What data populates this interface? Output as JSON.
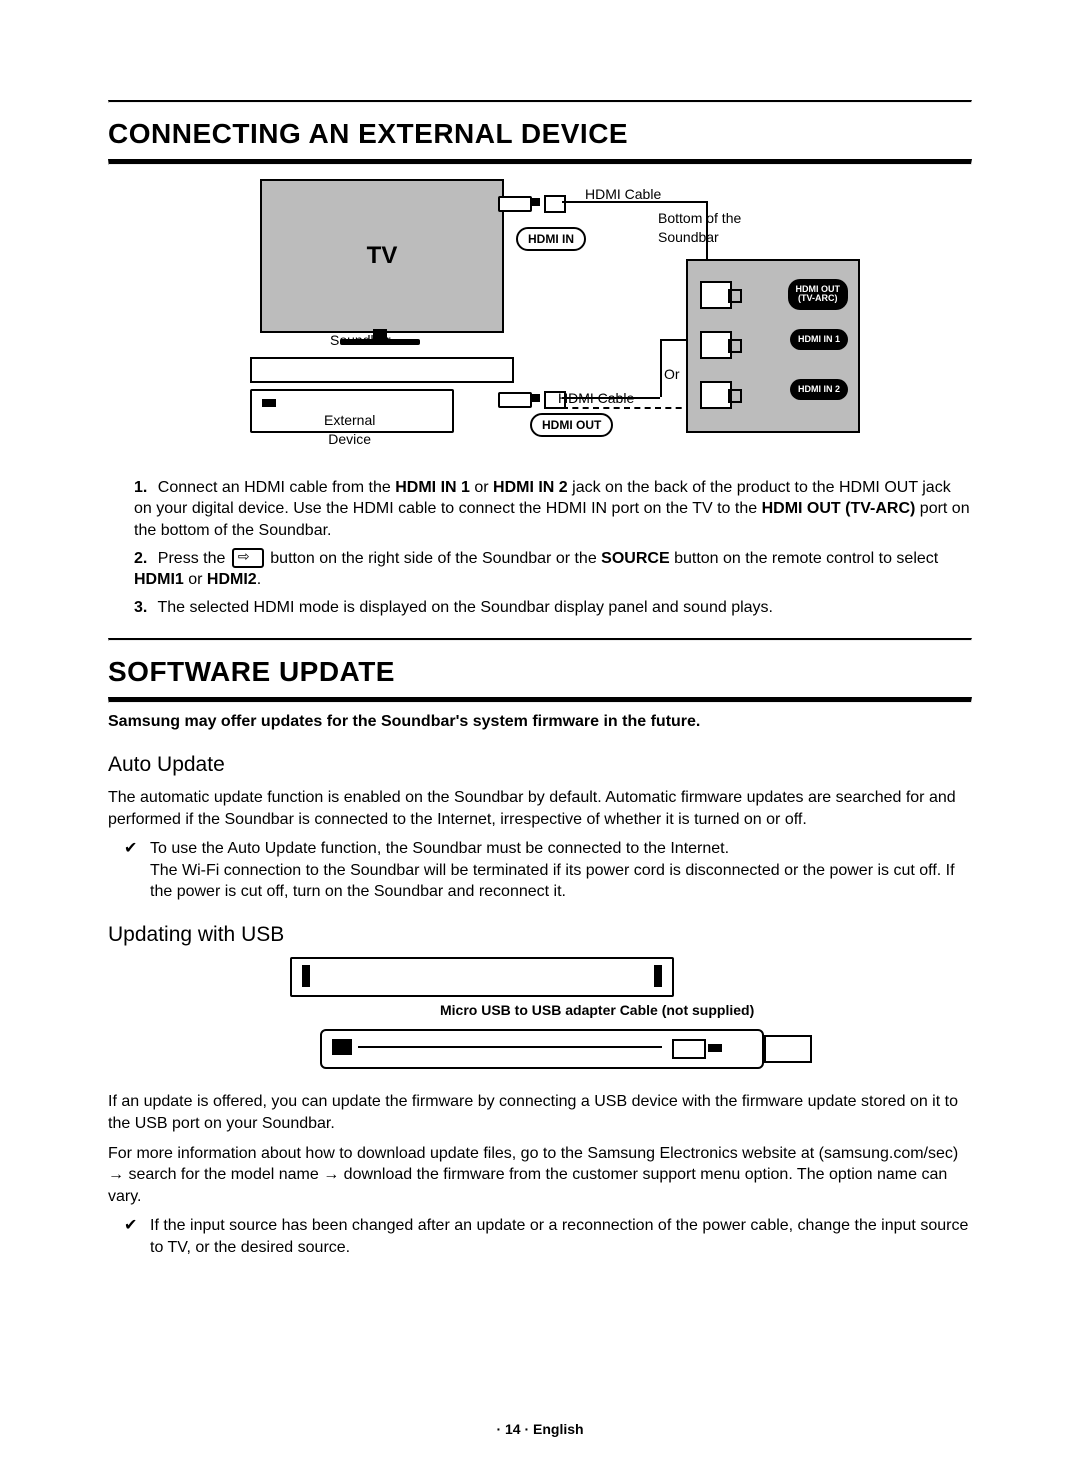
{
  "sections": {
    "connect": {
      "title": "CONNECTING AN EXTERNAL DEVICE",
      "diagram": {
        "tv_label": "TV",
        "hdmi_in_pill": "HDMI IN",
        "hdmi_out_pill": "HDMI OUT",
        "soundbar_label": "Soundbar",
        "external_device_label": "External\nDevice",
        "hdmi_cable_label_top": "HDMI Cable",
        "hdmi_cable_label_bottom": "HDMI Cable",
        "bottom_of_soundbar": "Bottom of the\nSoundbar",
        "or_label": "Or",
        "ports": {
          "out": "HDMI OUT\n(TV-ARC)",
          "in1": "HDMI IN 1",
          "in2": "HDMI IN 2"
        }
      },
      "steps": [
        {
          "n": "1.",
          "pre": "Connect an HDMI cable from the ",
          "b1": "HDMI IN 1",
          "mid1": " or ",
          "b2": "HDMI IN 2",
          "mid2": " jack on the back of the product to the HDMI OUT jack on your digital device. Use the HDMI cable to connect the HDMI IN port on the TV to the ",
          "b3": "HDMI OUT (TV-ARC)",
          "tail": " port on the bottom of the Soundbar."
        },
        {
          "n": "2.",
          "pre": "Press the ",
          "mid": " button on the right side of the Soundbar or the ",
          "b1": "SOURCE",
          "mid2": " button on the remote control to select ",
          "b2": "HDMI1",
          "or": " or ",
          "b3": "HDMI2",
          "tail": "."
        },
        {
          "n": "3.",
          "text": "The selected HDMI mode is displayed on the Soundbar display panel and sound plays."
        }
      ]
    },
    "software": {
      "title": "SOFTWARE UPDATE",
      "intro_bold": "Samsung may offer updates for the Soundbar's system firmware in the future.",
      "auto": {
        "heading": "Auto Update",
        "para": "The automatic update function is enabled on the Soundbar by default. Automatic firmware updates are searched for and performed if the Soundbar is connected to the Internet, irrespective of whether it is turned on or off.",
        "check": "To use the Auto Update function, the Soundbar must be connected to the Internet.\nThe Wi-Fi connection to the Soundbar will be terminated if its power cord is disconnected or the power is cut off. If the power is cut off, turn on the Soundbar and reconnect it."
      },
      "usb": {
        "heading": "Updating with USB",
        "caption": "Micro USB to USB adapter Cable (not supplied)",
        "para1": "If an update is offered, you can update the firmware by connecting a USB device with the firmware update stored on it to the USB port on your Soundbar.",
        "para2_pre": "For more information about how to download update files, go to the Samsung Electronics website at (samsung.com/sec) ",
        "arrow1": "→",
        "para2_mid1": " search for the model name ",
        "arrow2": "→",
        "para2_tail": " download the firmware from the customer support menu option. The option name can vary.",
        "check": "If the input source has been changed after an update or a reconnection of the power cable, change the input source to TV, or the desired source."
      }
    }
  },
  "footer": "· 14 · English"
}
